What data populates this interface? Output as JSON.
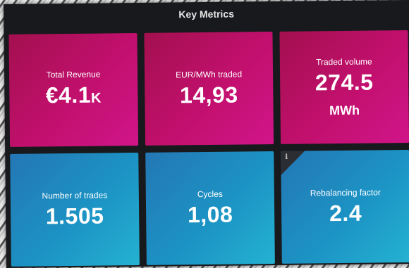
{
  "panel": {
    "title": "Key Metrics"
  },
  "tiles": [
    {
      "label": "Total Revenue",
      "value": "€4.1",
      "suffix": "K"
    },
    {
      "label": "EUR/MWh traded",
      "value": "14,93"
    },
    {
      "label": "Traded volume",
      "value": "274.5",
      "unit": "MWh"
    },
    {
      "label": "Number of trades",
      "value": "1.505"
    },
    {
      "label": "Cycles",
      "value": "1,08"
    },
    {
      "label": "Rebalancing factor",
      "value": "2.4",
      "info": "i"
    }
  ],
  "colors": {
    "panel_bg": "#18191c",
    "tile_magenta": "#c2106e",
    "tile_blue": "#1c93c4",
    "text": "#ffffff"
  }
}
